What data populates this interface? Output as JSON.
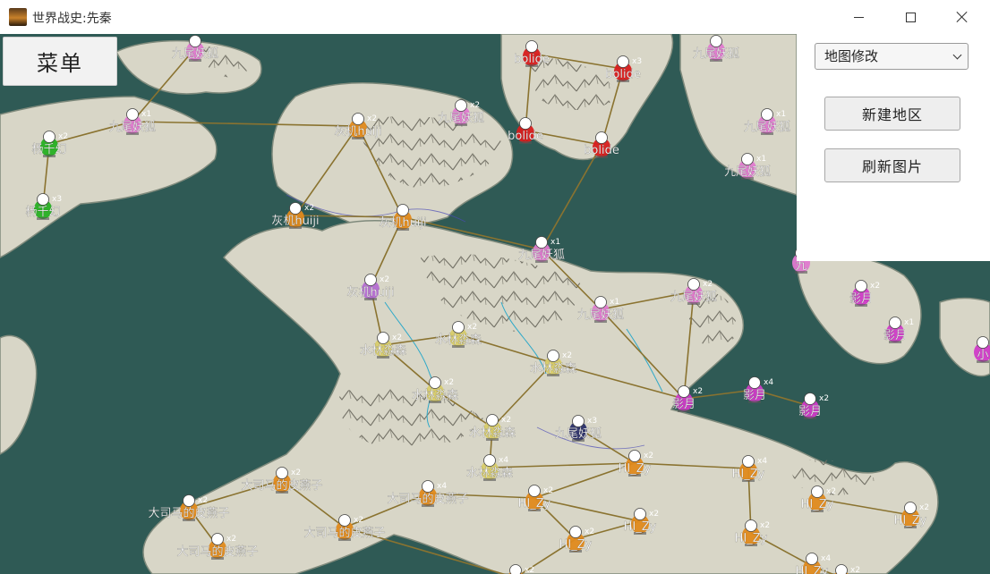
{
  "window": {
    "title": "世界战史:先秦",
    "icon": "game-app-icon",
    "minimize_icon": "minimize-icon",
    "maximize_icon": "maximize-icon",
    "close_icon": "close-icon"
  },
  "menu": {
    "label": "菜单"
  },
  "side_panel": {
    "select_value": "地图修改",
    "new_region_label": "新建地区",
    "refresh_image_label": "刷新图片"
  },
  "map": {
    "colors": {
      "sea": "#2f5a55",
      "land": "#d8d6c7",
      "route": "#8a7330",
      "green": "#27b023",
      "pink": "#e07ad0",
      "orange": "#e08a1c",
      "red": "#d81e1e",
      "yellow": "#d8cc6a",
      "magenta": "#d03cc8",
      "purple": "#b46ed2",
      "navy": "#2a2f6a"
    },
    "units": [
      {
        "name": "九尾妖狐",
        "count": "",
        "color": "pink"
      },
      {
        "name": "杨千幻",
        "count": "x2",
        "color": "green"
      },
      {
        "name": "杨千幻",
        "count": "x3",
        "color": "green"
      },
      {
        "name": "九尾妖狐",
        "count": "x1",
        "color": "pink"
      },
      {
        "name": "灰机huiji",
        "count": "x2",
        "color": "orange"
      },
      {
        "name": "灰机huiji",
        "count": "x2",
        "color": "orange"
      },
      {
        "name": "灰机huiji",
        "count": "x2",
        "color": "purple"
      },
      {
        "name": "灰机huiji",
        "count": "",
        "color": "orange"
      },
      {
        "name": "九尾妖狐",
        "count": "x2",
        "color": "pink"
      },
      {
        "name": "bolide",
        "count": "",
        "color": "red"
      },
      {
        "name": "bolide",
        "count": "x3",
        "color": "red"
      },
      {
        "name": "bolide",
        "count": "",
        "color": "red"
      },
      {
        "name": "bolide",
        "count": "",
        "color": "red"
      },
      {
        "name": "九尾妖狐",
        "count": "",
        "color": "pink"
      },
      {
        "name": "九尾妖狐",
        "count": "x1",
        "color": "pink"
      },
      {
        "name": "九尾妖狐",
        "count": "x1",
        "color": "pink"
      },
      {
        "name": "九尾妖狐",
        "count": "x1",
        "color": "pink"
      },
      {
        "name": "九尾妖狐",
        "count": "x1",
        "color": "pink"
      },
      {
        "name": "九尾妖狐",
        "count": "x2",
        "color": "pink"
      },
      {
        "name": "九",
        "count": "",
        "color": "pink"
      },
      {
        "name": "影月",
        "count": "x2",
        "color": "magenta"
      },
      {
        "name": "影月",
        "count": "x1",
        "color": "magenta"
      },
      {
        "name": "小",
        "count": "",
        "color": "magenta"
      },
      {
        "name": "水林淼森",
        "count": "x2",
        "color": "yellow"
      },
      {
        "name": "水林淼森",
        "count": "x2",
        "color": "yellow"
      },
      {
        "name": "水林淼森",
        "count": "x2",
        "color": "yellow"
      },
      {
        "name": "水林淼森",
        "count": "x2",
        "color": "yellow"
      },
      {
        "name": "水林淼森",
        "count": "x2",
        "color": "yellow"
      },
      {
        "name": "水林淼森",
        "count": "x4",
        "color": "yellow"
      },
      {
        "name": "九尾妖狐",
        "count": "x3",
        "color": "navy"
      },
      {
        "name": "影月",
        "count": "x2",
        "color": "magenta"
      },
      {
        "name": "影月",
        "count": "x4",
        "color": "magenta"
      },
      {
        "name": "影月",
        "count": "x2",
        "color": "magenta"
      },
      {
        "name": "HI_Zy",
        "count": "x2",
        "color": "orange"
      },
      {
        "name": "HI_Zy",
        "count": "x4",
        "color": "orange"
      },
      {
        "name": "HI_Zy",
        "count": "x2",
        "color": "orange"
      },
      {
        "name": "HI_Zy",
        "count": "x2",
        "color": "orange"
      },
      {
        "name": "HI_Zy",
        "count": "x2",
        "color": "orange"
      },
      {
        "name": "HI_Zy",
        "count": "x2",
        "color": "orange"
      },
      {
        "name": "HI_Zy",
        "count": "x2",
        "color": "orange"
      },
      {
        "name": "HI_Zy",
        "count": "x2",
        "color": "orange"
      },
      {
        "name": "HI_Zy",
        "count": "x4",
        "color": "orange"
      },
      {
        "name": "HI_Zy",
        "count": "x2",
        "color": "orange"
      },
      {
        "name": "大司马的皮燕子",
        "count": "x2",
        "color": "orange"
      },
      {
        "name": "大司马的皮燕子",
        "count": "x2",
        "color": "orange"
      },
      {
        "name": "大司马的皮燕子",
        "count": "x2",
        "color": "orange"
      },
      {
        "name": "大司马的皮燕子",
        "count": "x4",
        "color": "orange"
      },
      {
        "name": "大司马的皮燕子",
        "count": "x2",
        "color": "orange"
      },
      {
        "name": "",
        "count": "x2",
        "color": "orange"
      }
    ]
  }
}
